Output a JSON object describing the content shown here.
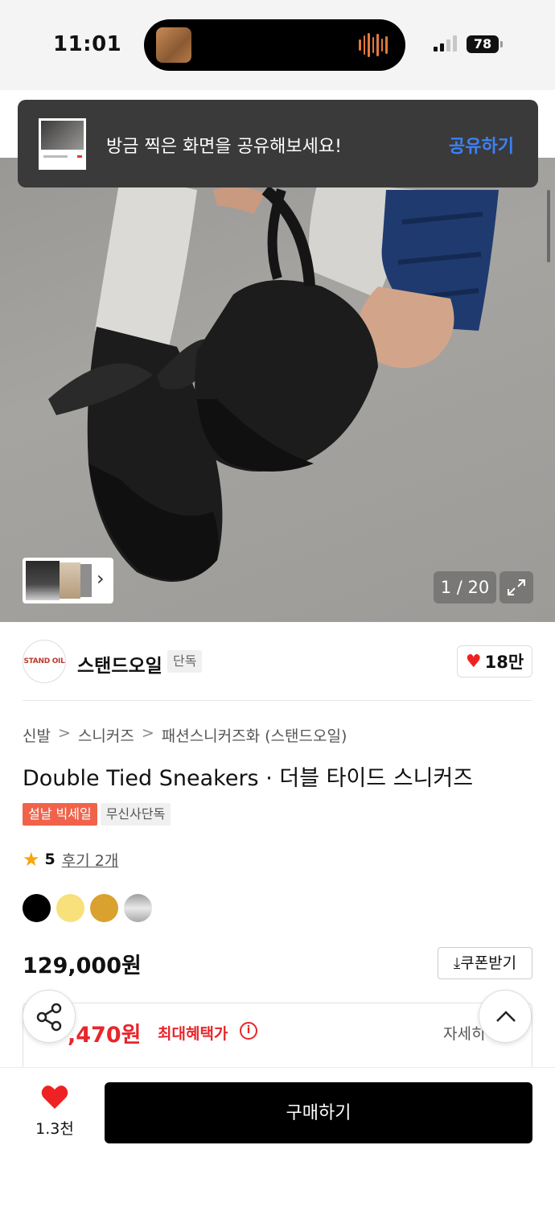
{
  "status_bar": {
    "time": "11:01",
    "battery": "78"
  },
  "toast": {
    "message": "방금 찍은 화면을 공유해보세요!",
    "action": "공유하기"
  },
  "gallery": {
    "counter": "1 / 20"
  },
  "brand": {
    "logo_text": "STAND OIL",
    "name": "스탠드오일",
    "badge": "단독",
    "likes": "18만"
  },
  "product": {
    "breadcrumb": [
      "신발",
      "스니커즈",
      "패션스니커즈화 (스탠드오일)"
    ],
    "breadcrumb_sep": ">",
    "title": "Double Tied Sneakers · 더블 타이드 스니커즈",
    "tags": [
      "설날 빅세일",
      "무신사단독"
    ],
    "rating_score": "5",
    "reviews": "후기 2개",
    "colors": [
      "#000000",
      "#f8e07a",
      "#d9a12e",
      "#bdbdbd"
    ],
    "price": "129,000원",
    "coupon_label": "쿠폰받기"
  },
  "benefit": {
    "max_price": ",470원",
    "max_label": "최대혜택가",
    "detail_label": "자세히"
  },
  "bottom_bar": {
    "wish_count": "1.3천",
    "buy_label": "구매하기"
  }
}
